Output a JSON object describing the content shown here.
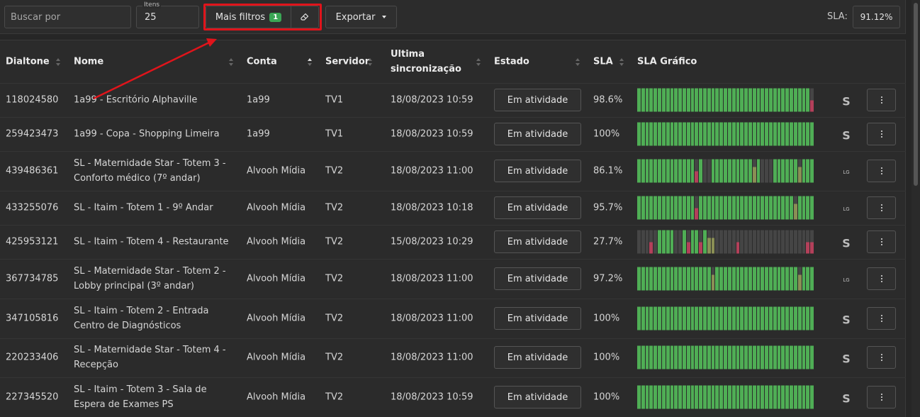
{
  "toolbar": {
    "search_placeholder": "Buscar por",
    "items_label": "Itens",
    "items_value": "25",
    "more_filters_label": "Mais filtros",
    "filters_count": "1",
    "export_label": "Exportar",
    "sla_label": "SLA:",
    "sla_value": "91.12%"
  },
  "table": {
    "headers": {
      "dialtone": "Dialtone",
      "name": "Nome",
      "account": "Conta",
      "server": "Servidor",
      "last_sync_1": "Ultima",
      "last_sync_2": "sincronização",
      "state": "Estado",
      "sla": "SLA",
      "sla_chart": "SLA Gráfico"
    },
    "rows": [
      {
        "dialtone": "118024580",
        "name": "1a99 - Escritório Alphaville",
        "account": "1a99",
        "server": "TV1",
        "sync": "18/08/2023 10:59",
        "state": "Em atividade",
        "sla": "98.6%",
        "vendor": "S"
      },
      {
        "dialtone": "259423473",
        "name": "1a99 - Copa - Shopping Limeira",
        "account": "1a99",
        "server": "TV1",
        "sync": "18/08/2023 10:59",
        "state": "Em atividade",
        "sla": "100%",
        "vendor": "S"
      },
      {
        "dialtone": "439486361",
        "name": "SL - Maternidade Star - Totem 3 - Conforto médico (7º andar)",
        "account": "Alvooh Mídia",
        "server": "TV2",
        "sync": "18/08/2023 11:00",
        "state": "Em atividade",
        "sla": "86.1%",
        "vendor": "LG"
      },
      {
        "dialtone": "433255076",
        "name": "SL - Itaim - Totem 1 - 9º Andar",
        "account": "Alvooh Mídia",
        "server": "TV2",
        "sync": "18/08/2023 10:18",
        "state": "Em atividade",
        "sla": "95.7%",
        "vendor": "LG"
      },
      {
        "dialtone": "425953121",
        "name": "SL - Itaim - Totem 4 - Restaurante",
        "account": "Alvooh Mídia",
        "server": "TV2",
        "sync": "15/08/2023 10:29",
        "state": "Em atividade",
        "sla": "27.7%",
        "vendor": "S"
      },
      {
        "dialtone": "367734785",
        "name": "SL - Maternidade Star - Totem 2 - Lobby principal (3º andar)",
        "account": "Alvooh Mídia",
        "server": "TV2",
        "sync": "18/08/2023 11:00",
        "state": "Em atividade",
        "sla": "97.2%",
        "vendor": "LG"
      },
      {
        "dialtone": "347105816",
        "name": "SL - Itaim - Totem 2 - Entrada Centro de Diagnósticos",
        "account": "Alvooh Mídia",
        "server": "TV2",
        "sync": "18/08/2023 11:00",
        "state": "Em atividade",
        "sla": "100%",
        "vendor": "S"
      },
      {
        "dialtone": "220233406",
        "name": "SL - Maternidade Star - Totem 4 - Recepção",
        "account": "Alvooh Mídia",
        "server": "TV2",
        "sync": "18/08/2023 11:00",
        "state": "Em atividade",
        "sla": "100%",
        "vendor": "S"
      },
      {
        "dialtone": "227345520",
        "name": "SL - Itaim - Totem 3 - Sala de Espera de Exames PS",
        "account": "Alvooh Mídia",
        "server": "TV2",
        "sync": "18/08/2023 10:59",
        "state": "Em atividade",
        "sla": "100%",
        "vendor": "S"
      }
    ]
  },
  "sla_bars": [
    "GGGGGGGGGGGGGGGGGGGGGGGGGGGGGGGGGGGGGGGGGGR",
    "GGGGGGGGGGGGGGGGGGGGGGGGGGGGGGGGGGGGGGGGGGG",
    "GGGGGGGGGGGGGGRGDDGGGGGGGGGGOGDDDGGGGGGOGGG",
    "GGGGGGGGGGGGGGRGGGGGGGGGGGGGGGGGGGGGGGOGGGG",
    "DDDRDGGGGDDGRGGRGOODDDDDRDDDDDDDDDDDDDDDDRR",
    "GGGGGGGGGGGGGGGGGGOGGGGGGGGGGGGGGGGGGGGOGGG",
    "GGGGGGGGGGGGGGGGGGGGGGGGGGGGGGGGGGGGGGGGGGG",
    "GGGGGGGGGGGGGGGGGGGGGGGGGGGGGGGGGGGGGGGGGGG",
    "GGGGGGGGGGGGGGGGGGGGGGGGGGGGGGGGGGGGGGGGGGG"
  ],
  "colors": {
    "ok": "#4fae55",
    "degraded": "#8a8f55",
    "down": "#b3405a",
    "offline": "#454545",
    "annotation": "#e0141b"
  },
  "icons": {
    "eraser": "eraser-icon",
    "sort": "sort-icon",
    "kebab": "more-vertical-icon"
  }
}
